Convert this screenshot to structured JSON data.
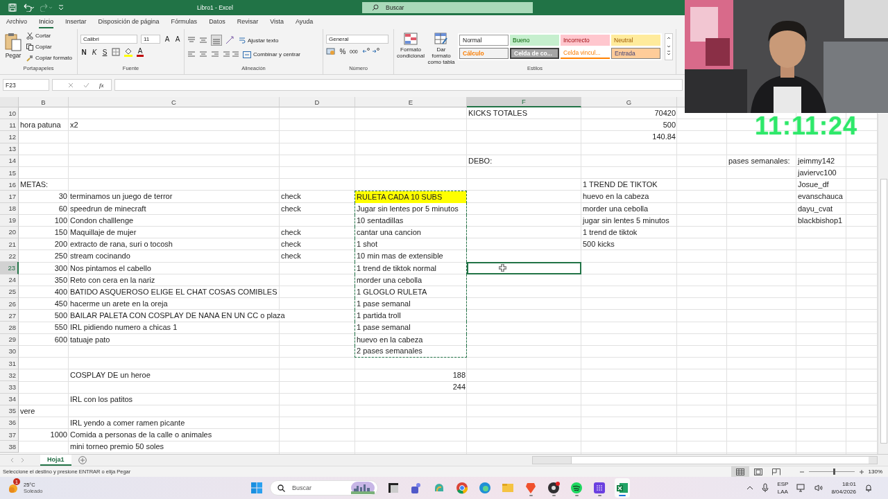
{
  "window": {
    "title": "Libro1 - Excel",
    "search_placeholder": "Buscar"
  },
  "ribbon_tabs": [
    {
      "label": "Archivo",
      "selected": false
    },
    {
      "label": "Inicio",
      "selected": true
    },
    {
      "label": "Insertar",
      "selected": false
    },
    {
      "label": "Disposición de página",
      "selected": false
    },
    {
      "label": "Fórmulas",
      "selected": false
    },
    {
      "label": "Datos",
      "selected": false
    },
    {
      "label": "Revisar",
      "selected": false
    },
    {
      "label": "Vista",
      "selected": false
    },
    {
      "label": "Ayuda",
      "selected": false
    }
  ],
  "ribbon": {
    "clipboard": {
      "label": "Portapapeles",
      "paste": "Pegar",
      "cut": "Cortar",
      "copy": "Copiar",
      "format_painter": "Copiar formato"
    },
    "font": {
      "label": "Fuente",
      "name": "Calibri",
      "size": "11",
      "grow": "A",
      "shrink": "A",
      "bold": "N",
      "italic": "K",
      "underline": "S",
      "font_color": "A"
    },
    "alignment": {
      "label": "Alineación",
      "wrap": "Ajustar texto",
      "merge": "Combinar y centrar"
    },
    "number": {
      "label": "Número",
      "format": "General",
      "percent": "%",
      "thousands": "000"
    },
    "styles": {
      "label": "Estilos",
      "conditional": "Formato condicional",
      "table": "Dar formato como tabla",
      "gallery": [
        {
          "label": "Normal",
          "kind": "normal"
        },
        {
          "label": "Bueno",
          "kind": "good"
        },
        {
          "label": "Incorrecto",
          "kind": "bad"
        },
        {
          "label": "Neutral",
          "kind": "neutral"
        },
        {
          "label": "Cálculo",
          "kind": "calc"
        },
        {
          "label": "Celda de co...",
          "kind": "check"
        },
        {
          "label": "Celda vincul...",
          "kind": "linked"
        },
        {
          "label": "Entrada",
          "kind": "input"
        }
      ]
    }
  },
  "formula_bar": {
    "name_box": "F23",
    "function_symbol": "fx"
  },
  "sheet": {
    "columns": [
      {
        "label": "B",
        "selected": false
      },
      {
        "label": "C",
        "selected": false
      },
      {
        "label": "D",
        "selected": false
      },
      {
        "label": "E",
        "selected": false
      },
      {
        "label": "F",
        "selected": true
      },
      {
        "label": "G",
        "selected": false
      }
    ],
    "rows": [
      {
        "number": "10",
        "selected": false,
        "cells": {
          "f": {
            "text": "KICKS TOTALES"
          },
          "g": {
            "text": "70420",
            "kind": "number"
          }
        }
      },
      {
        "number": "11",
        "selected": false,
        "cells": {
          "b": {
            "text": "hora patuna"
          },
          "c": {
            "text": "x2"
          },
          "g": {
            "text": "500",
            "kind": "number"
          }
        }
      },
      {
        "number": "12",
        "selected": false,
        "cells": {
          "g": {
            "text": "140.84",
            "kind": "number"
          }
        }
      },
      {
        "number": "13",
        "selected": false,
        "cells": {}
      },
      {
        "number": "14",
        "selected": false,
        "cells": {
          "f": {
            "text": "DEBO:"
          },
          "i": {
            "text": "pases semanales:"
          },
          "j": {
            "text": "jeimmy142"
          }
        }
      },
      {
        "number": "15",
        "selected": false,
        "cells": {
          "j": {
            "text": "javiervc100"
          }
        }
      },
      {
        "number": "16",
        "selected": false,
        "cells": {
          "b": {
            "text": "METAS:"
          },
          "g": {
            "text": "1 TREND DE TIKTOK"
          },
          "j": {
            "text": "Josue_df"
          }
        }
      },
      {
        "number": "17",
        "selected": false,
        "cells": {
          "b": {
            "text": "30",
            "kind": "number"
          },
          "c": {
            "text": "terminamos un juego de terror"
          },
          "d": {
            "text": "check"
          },
          "e": {
            "text": "RULETA CADA 10 SUBS",
            "color": "#ffff00",
            "copied": true
          },
          "g": {
            "text": "huevo en la cabeza"
          },
          "j": {
            "text": "evanschauca"
          }
        }
      },
      {
        "number": "18",
        "selected": false,
        "cells": {
          "b": {
            "text": "60",
            "kind": "number"
          },
          "c": {
            "text": "speedrun de minecraft"
          },
          "d": {
            "text": "check"
          },
          "e": {
            "text": "Jugar sin lentes por 5 minutos",
            "copied": true
          },
          "g": {
            "text": "morder una cebolla"
          },
          "j": {
            "text": "dayu_cvat"
          }
        }
      },
      {
        "number": "19",
        "selected": false,
        "cells": {
          "b": {
            "text": "100",
            "kind": "number"
          },
          "c": {
            "text": "Condon challlenge"
          },
          "e": {
            "text": "10 sentadillas",
            "copied": true
          },
          "g": {
            "text": "jugar sin lentes 5 minutos"
          },
          "j": {
            "text": "blackbishop1"
          }
        }
      },
      {
        "number": "20",
        "selected": false,
        "cells": {
          "b": {
            "text": "150",
            "kind": "number"
          },
          "c": {
            "text": "Maquillaje de mujer"
          },
          "d": {
            "text": "check"
          },
          "e": {
            "text": "cantar una cancion",
            "copied": true
          },
          "g": {
            "text": "1 trend de tiktok"
          }
        }
      },
      {
        "number": "21",
        "selected": false,
        "cells": {
          "b": {
            "text": "200",
            "kind": "number"
          },
          "c": {
            "text": "extracto de rana, suri o tocosh"
          },
          "d": {
            "text": "check"
          },
          "e": {
            "text": "1 shot",
            "copied": true
          },
          "g": {
            "text": "500 kicks"
          }
        }
      },
      {
        "number": "22",
        "selected": false,
        "cells": {
          "b": {
            "text": "250",
            "kind": "number"
          },
          "c": {
            "text": "stream cocinando"
          },
          "d": {
            "text": "check"
          },
          "e": {
            "text": "10 min mas de extensible",
            "copied": true
          }
        }
      },
      {
        "number": "23",
        "selected": true,
        "cells": {
          "b": {
            "text": "300",
            "kind": "number"
          },
          "c": {
            "text": "Nos pintamos el cabello"
          },
          "e": {
            "text": "1 trend de tiktok normal",
            "copied": true
          }
        }
      },
      {
        "number": "24",
        "selected": false,
        "cells": {
          "b": {
            "text": "350",
            "kind": "number"
          },
          "c": {
            "text": "Reto con cera en la nariz"
          },
          "e": {
            "text": "morder una cebolla",
            "copied": true
          }
        }
      },
      {
        "number": "25",
        "selected": false,
        "cells": {
          "b": {
            "text": "400",
            "kind": "number"
          },
          "c": {
            "text": "BATIDO ASQUEROSO ELIGE EL CHAT COSAS COMIBLES"
          },
          "e": {
            "text": "1 GLOGLO RULETA",
            "copied": true
          }
        }
      },
      {
        "number": "26",
        "selected": false,
        "cells": {
          "b": {
            "text": "450",
            "kind": "number"
          },
          "c": {
            "text": "hacerme un arete en la oreja"
          },
          "e": {
            "text": "1 pase semanal",
            "copied": true
          }
        }
      },
      {
        "number": "27",
        "selected": false,
        "cells": {
          "b": {
            "text": "500",
            "kind": "number"
          },
          "c": {
            "text": "BAILAR PALETA CON COSPLAY DE NANA EN UN CC o plaza"
          },
          "e": {
            "text": "1 partida troll",
            "copied": true
          }
        }
      },
      {
        "number": "28",
        "selected": false,
        "cells": {
          "b": {
            "text": "550",
            "kind": "number"
          },
          "c": {
            "text": "IRL pidiendo numero a chicas 1"
          },
          "e": {
            "text": "1 pase semanal",
            "copied": true
          }
        }
      },
      {
        "number": "29",
        "selected": false,
        "cells": {
          "b": {
            "text": "600",
            "kind": "number"
          },
          "c": {
            "text": "tatuaje pato"
          },
          "e": {
            "text": "huevo en la cabeza",
            "copied": true
          }
        }
      },
      {
        "number": "30",
        "selected": false,
        "cells": {
          "e": {
            "text": "2 pases semanales",
            "copied": true
          }
        }
      },
      {
        "number": "31",
        "selected": false,
        "cells": {}
      },
      {
        "number": "32",
        "selected": false,
        "cells": {
          "c": {
            "text": "COSPLAY DE un heroe"
          },
          "e": {
            "text": "188",
            "kind": "number"
          }
        }
      },
      {
        "number": "33",
        "selected": false,
        "cells": {
          "e": {
            "text": "244",
            "kind": "number"
          }
        }
      },
      {
        "number": "34",
        "selected": false,
        "cells": {
          "c": {
            "text": "IRL con los patitos"
          }
        }
      },
      {
        "number": "35",
        "selected": false,
        "cells": {
          "b": {
            "text": "vere"
          }
        }
      },
      {
        "number": "36",
        "selected": false,
        "cells": {
          "c": {
            "text": "IRL yendo a comer ramen picante"
          }
        }
      },
      {
        "number": "37",
        "selected": false,
        "cells": {
          "b": {
            "text": "1000",
            "kind": "number"
          },
          "c": {
            "text": "Comida a personas de la calle o animales"
          }
        }
      },
      {
        "number": "38",
        "selected": false,
        "cells": {
          "c": {
            "text": "mini torneo premio 50 soles"
          }
        }
      }
    ]
  },
  "timer": "11:11:24",
  "sheet_tabs": [
    {
      "label": "Hoja1",
      "selected": true
    }
  ],
  "status_bar": {
    "message": "Seleccione el destino y presione ENTRAR o elija Pegar",
    "views": [
      {
        "kind": "normal",
        "selected": true
      },
      {
        "kind": "layout",
        "selected": false
      },
      {
        "kind": "break",
        "selected": false
      }
    ],
    "zoom": {
      "level": 0.55,
      "reading": "130%"
    }
  },
  "taskbar": {
    "weather": {
      "badge": "1",
      "temperature": "25°C",
      "condition": "Soleado"
    },
    "search_placeholder": "Buscar",
    "apps": [
      {
        "kind": "taskview",
        "running": false,
        "active": false
      },
      {
        "kind": "teams",
        "running": false,
        "active": false
      },
      {
        "kind": "copilot",
        "running": false,
        "active": false
      },
      {
        "kind": "chrome",
        "running": false,
        "active": false
      },
      {
        "kind": "edge",
        "running": false,
        "active": false
      },
      {
        "kind": "explorer",
        "running": false,
        "active": false
      },
      {
        "kind": "brave",
        "running": true,
        "active": false
      },
      {
        "kind": "obs",
        "running": true,
        "active": false
      },
      {
        "kind": "spotify",
        "running": true,
        "active": false
      },
      {
        "kind": "apps",
        "running": true,
        "active": false
      },
      {
        "kind": "excel",
        "running": true,
        "active": true
      }
    ],
    "language": "ESP",
    "layout": "LAA",
    "time": "18:01",
    "date": "8/04/2026"
  }
}
